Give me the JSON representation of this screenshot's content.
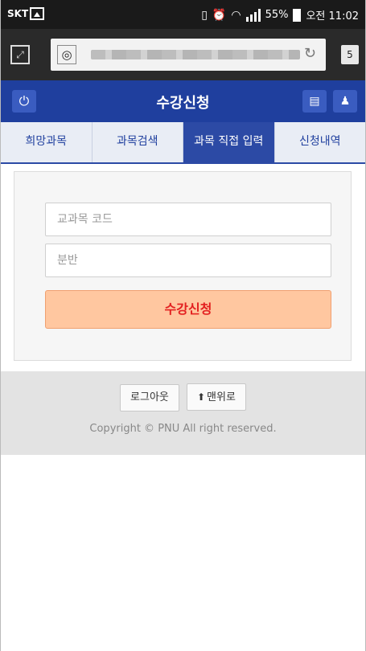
{
  "status_bar": {
    "carrier": "SKT",
    "battery": "55%",
    "time": "오전 11:02"
  },
  "browser": {
    "tab_count": "5"
  },
  "app": {
    "title": "수강신청"
  },
  "tabs": [
    {
      "label": "희망과목"
    },
    {
      "label": "과목검색"
    },
    {
      "label": "과목 직접 입력",
      "active": true
    },
    {
      "label": "신청내역"
    }
  ],
  "form": {
    "course_code_placeholder": "교과목 코드",
    "section_placeholder": "분반",
    "submit_label": "수강신청"
  },
  "footer": {
    "logout_label": "로그아웃",
    "top_label": "맨위로",
    "copyright": "Copyright © PNU All right reserved."
  }
}
